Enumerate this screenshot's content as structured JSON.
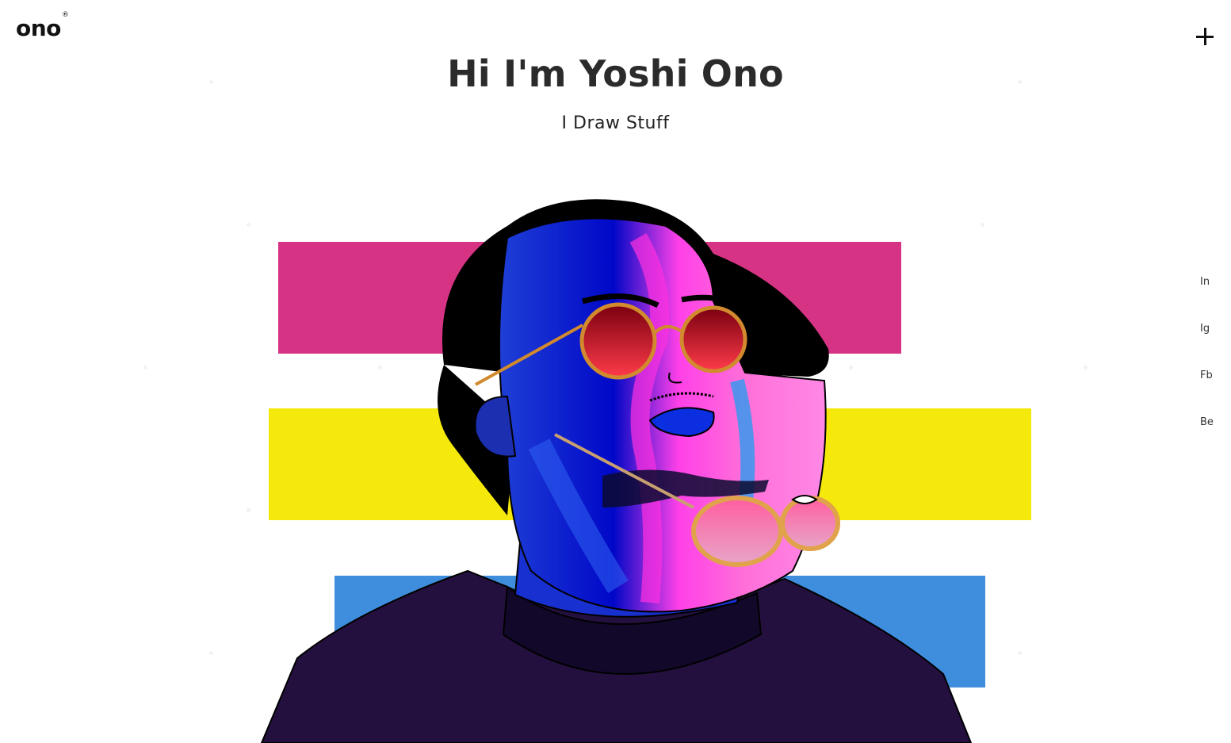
{
  "header": {
    "logo_text": "ono",
    "logo_mark": "®",
    "menu_icon": "plus-icon"
  },
  "hero": {
    "title": "Hi I'm Yoshi Ono",
    "subtitle": "I Draw Stuff"
  },
  "stripes": {
    "colors": [
      "#d63384",
      "#f5e90c",
      "#3f8ede"
    ]
  },
  "illustration": {
    "icon": "portrait-illustration"
  },
  "social": {
    "links": [
      "In",
      "Ig",
      "Fb",
      "Be"
    ]
  }
}
